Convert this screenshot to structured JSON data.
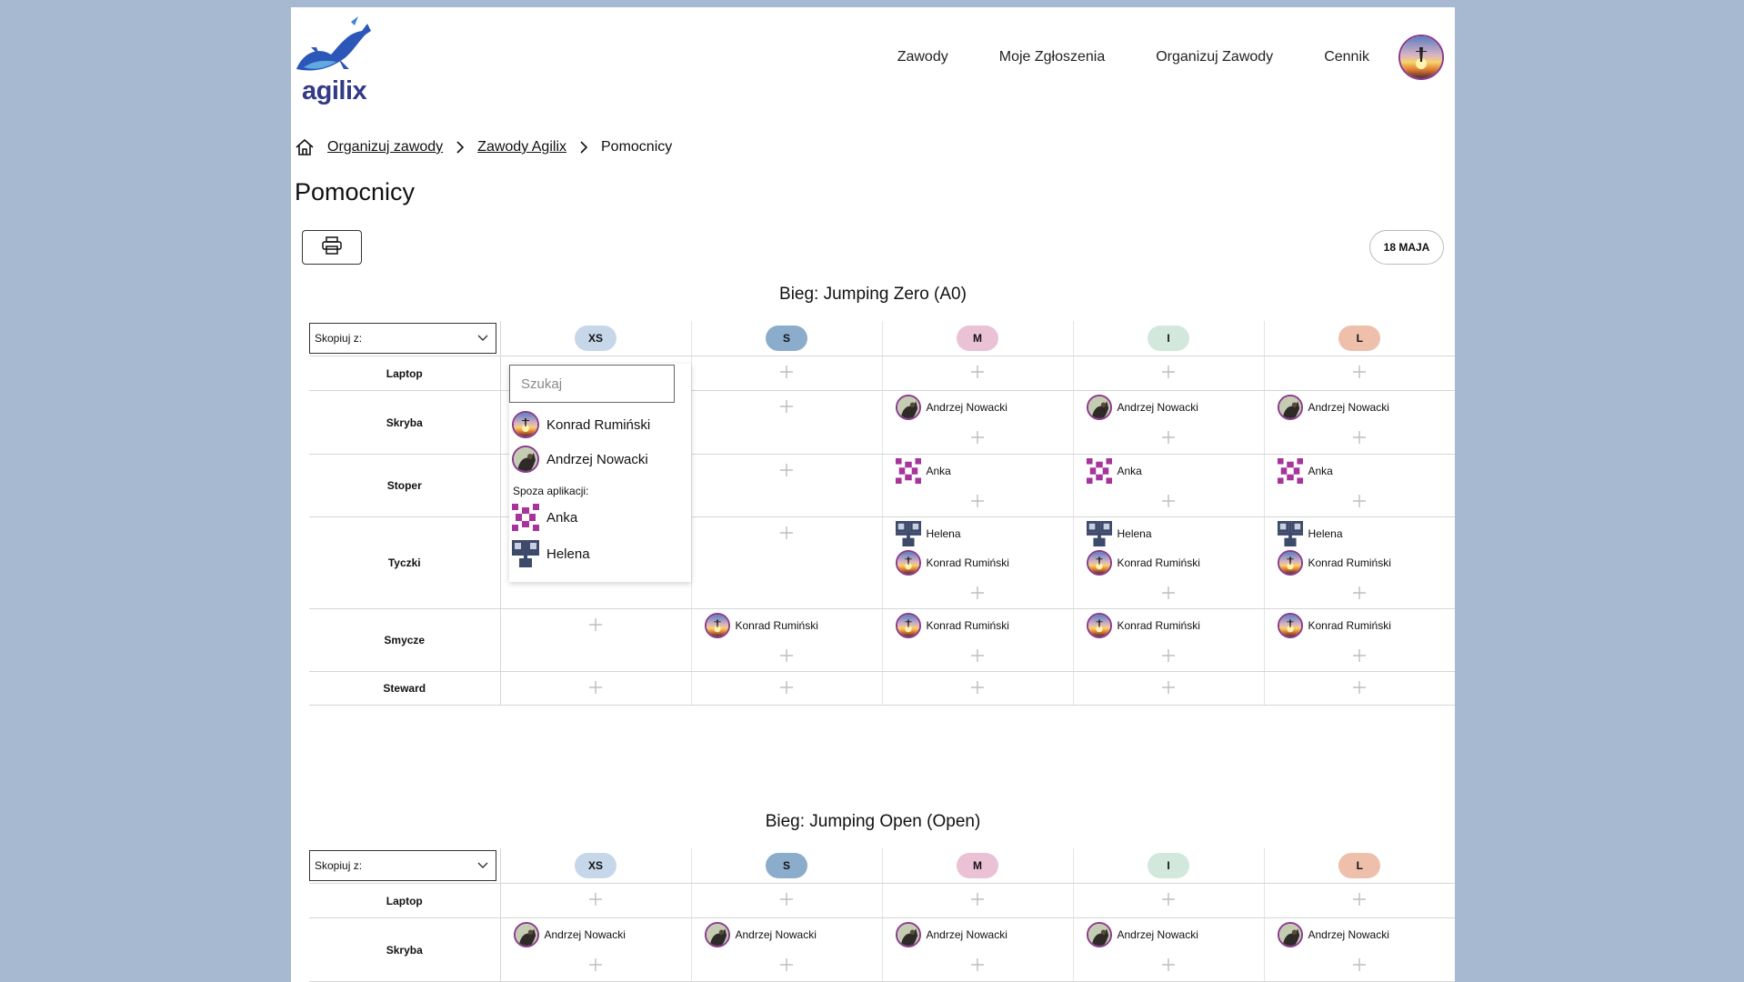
{
  "brand": {
    "name": "agilix"
  },
  "nav": {
    "items": [
      "Zawody",
      "Moje Zgłoszenia",
      "Organizuj Zawody",
      "Cennik"
    ]
  },
  "breadcrumb": {
    "items": [
      "Organizuj zawody",
      "Zawody Agilix"
    ],
    "current": "Pomocnicy"
  },
  "page": {
    "title": "Pomocnicy"
  },
  "toolbar": {
    "date_label": "18 MAJA"
  },
  "sizes": [
    {
      "label": "XS",
      "color": "#c6d7ea"
    },
    {
      "label": "S",
      "color": "#8caccb"
    },
    {
      "label": "M",
      "color": "#eac1d5"
    },
    {
      "label": "I",
      "color": "#d2e8dc"
    },
    {
      "label": "L",
      "color": "#eec0ac"
    }
  ],
  "copy_select": {
    "placeholder": "Skopiuj z:"
  },
  "runs": [
    {
      "title": "Bieg: Jumping Zero (A0)",
      "rows": [
        {
          "role": "Laptop",
          "cells": [
            [],
            [],
            [],
            [],
            []
          ]
        },
        {
          "role": "Skryba",
          "cells": [
            [],
            [],
            [
              {
                "name": "Andrzej Nowacki",
                "avatar": "dog"
              }
            ],
            [
              {
                "name": "Andrzej Nowacki",
                "avatar": "dog"
              }
            ],
            [
              {
                "name": "Andrzej Nowacki",
                "avatar": "dog"
              }
            ]
          ]
        },
        {
          "role": "Stoper",
          "cells": [
            [],
            [],
            [
              {
                "name": "Anka",
                "avatar": "pixel"
              }
            ],
            [
              {
                "name": "Anka",
                "avatar": "pixel"
              }
            ],
            [
              {
                "name": "Anka",
                "avatar": "pixel"
              }
            ]
          ]
        },
        {
          "role": "Tyczki",
          "cells": [
            [],
            [],
            [
              {
                "name": "Helena",
                "avatar": "cross"
              },
              {
                "name": "Konrad Rumiński",
                "avatar": "sunset"
              }
            ],
            [
              {
                "name": "Helena",
                "avatar": "cross"
              },
              {
                "name": "Konrad Rumiński",
                "avatar": "sunset"
              }
            ],
            [
              {
                "name": "Helena",
                "avatar": "cross"
              },
              {
                "name": "Konrad Rumiński",
                "avatar": "sunset"
              }
            ]
          ]
        },
        {
          "role": "Smycze",
          "cells": [
            [],
            [
              {
                "name": "Konrad Rumiński",
                "avatar": "sunset"
              }
            ],
            [
              {
                "name": "Konrad Rumiński",
                "avatar": "sunset"
              }
            ],
            [
              {
                "name": "Konrad Rumiński",
                "avatar": "sunset"
              }
            ],
            [
              {
                "name": "Konrad Rumiński",
                "avatar": "sunset"
              }
            ]
          ]
        },
        {
          "role": "Steward",
          "cells": [
            [],
            [],
            [],
            [],
            []
          ]
        }
      ]
    },
    {
      "title": "Bieg: Jumping Open (Open)",
      "rows": [
        {
          "role": "Laptop",
          "cells": [
            [],
            [],
            [],
            [],
            []
          ]
        },
        {
          "role": "Skryba",
          "cells": [
            [
              {
                "name": "Andrzej Nowacki",
                "avatar": "dog"
              }
            ],
            [
              {
                "name": "Andrzej Nowacki",
                "avatar": "dog"
              }
            ],
            [
              {
                "name": "Andrzej Nowacki",
                "avatar": "dog"
              }
            ],
            [
              {
                "name": "Andrzej Nowacki",
                "avatar": "dog"
              }
            ],
            [
              {
                "name": "Andrzej Nowacki",
                "avatar": "dog"
              }
            ]
          ]
        }
      ]
    }
  ],
  "dropdown": {
    "search_placeholder": "Szukaj",
    "app_users": [
      {
        "name": "Konrad Rumiński",
        "avatar": "sunset"
      },
      {
        "name": "Andrzej Nowacki",
        "avatar": "dog"
      }
    ],
    "outside_label": "Spoza aplikacji:",
    "outside_users": [
      {
        "name": "Anka",
        "avatar": "pixel"
      },
      {
        "name": "Helena",
        "avatar": "cross"
      }
    ]
  }
}
